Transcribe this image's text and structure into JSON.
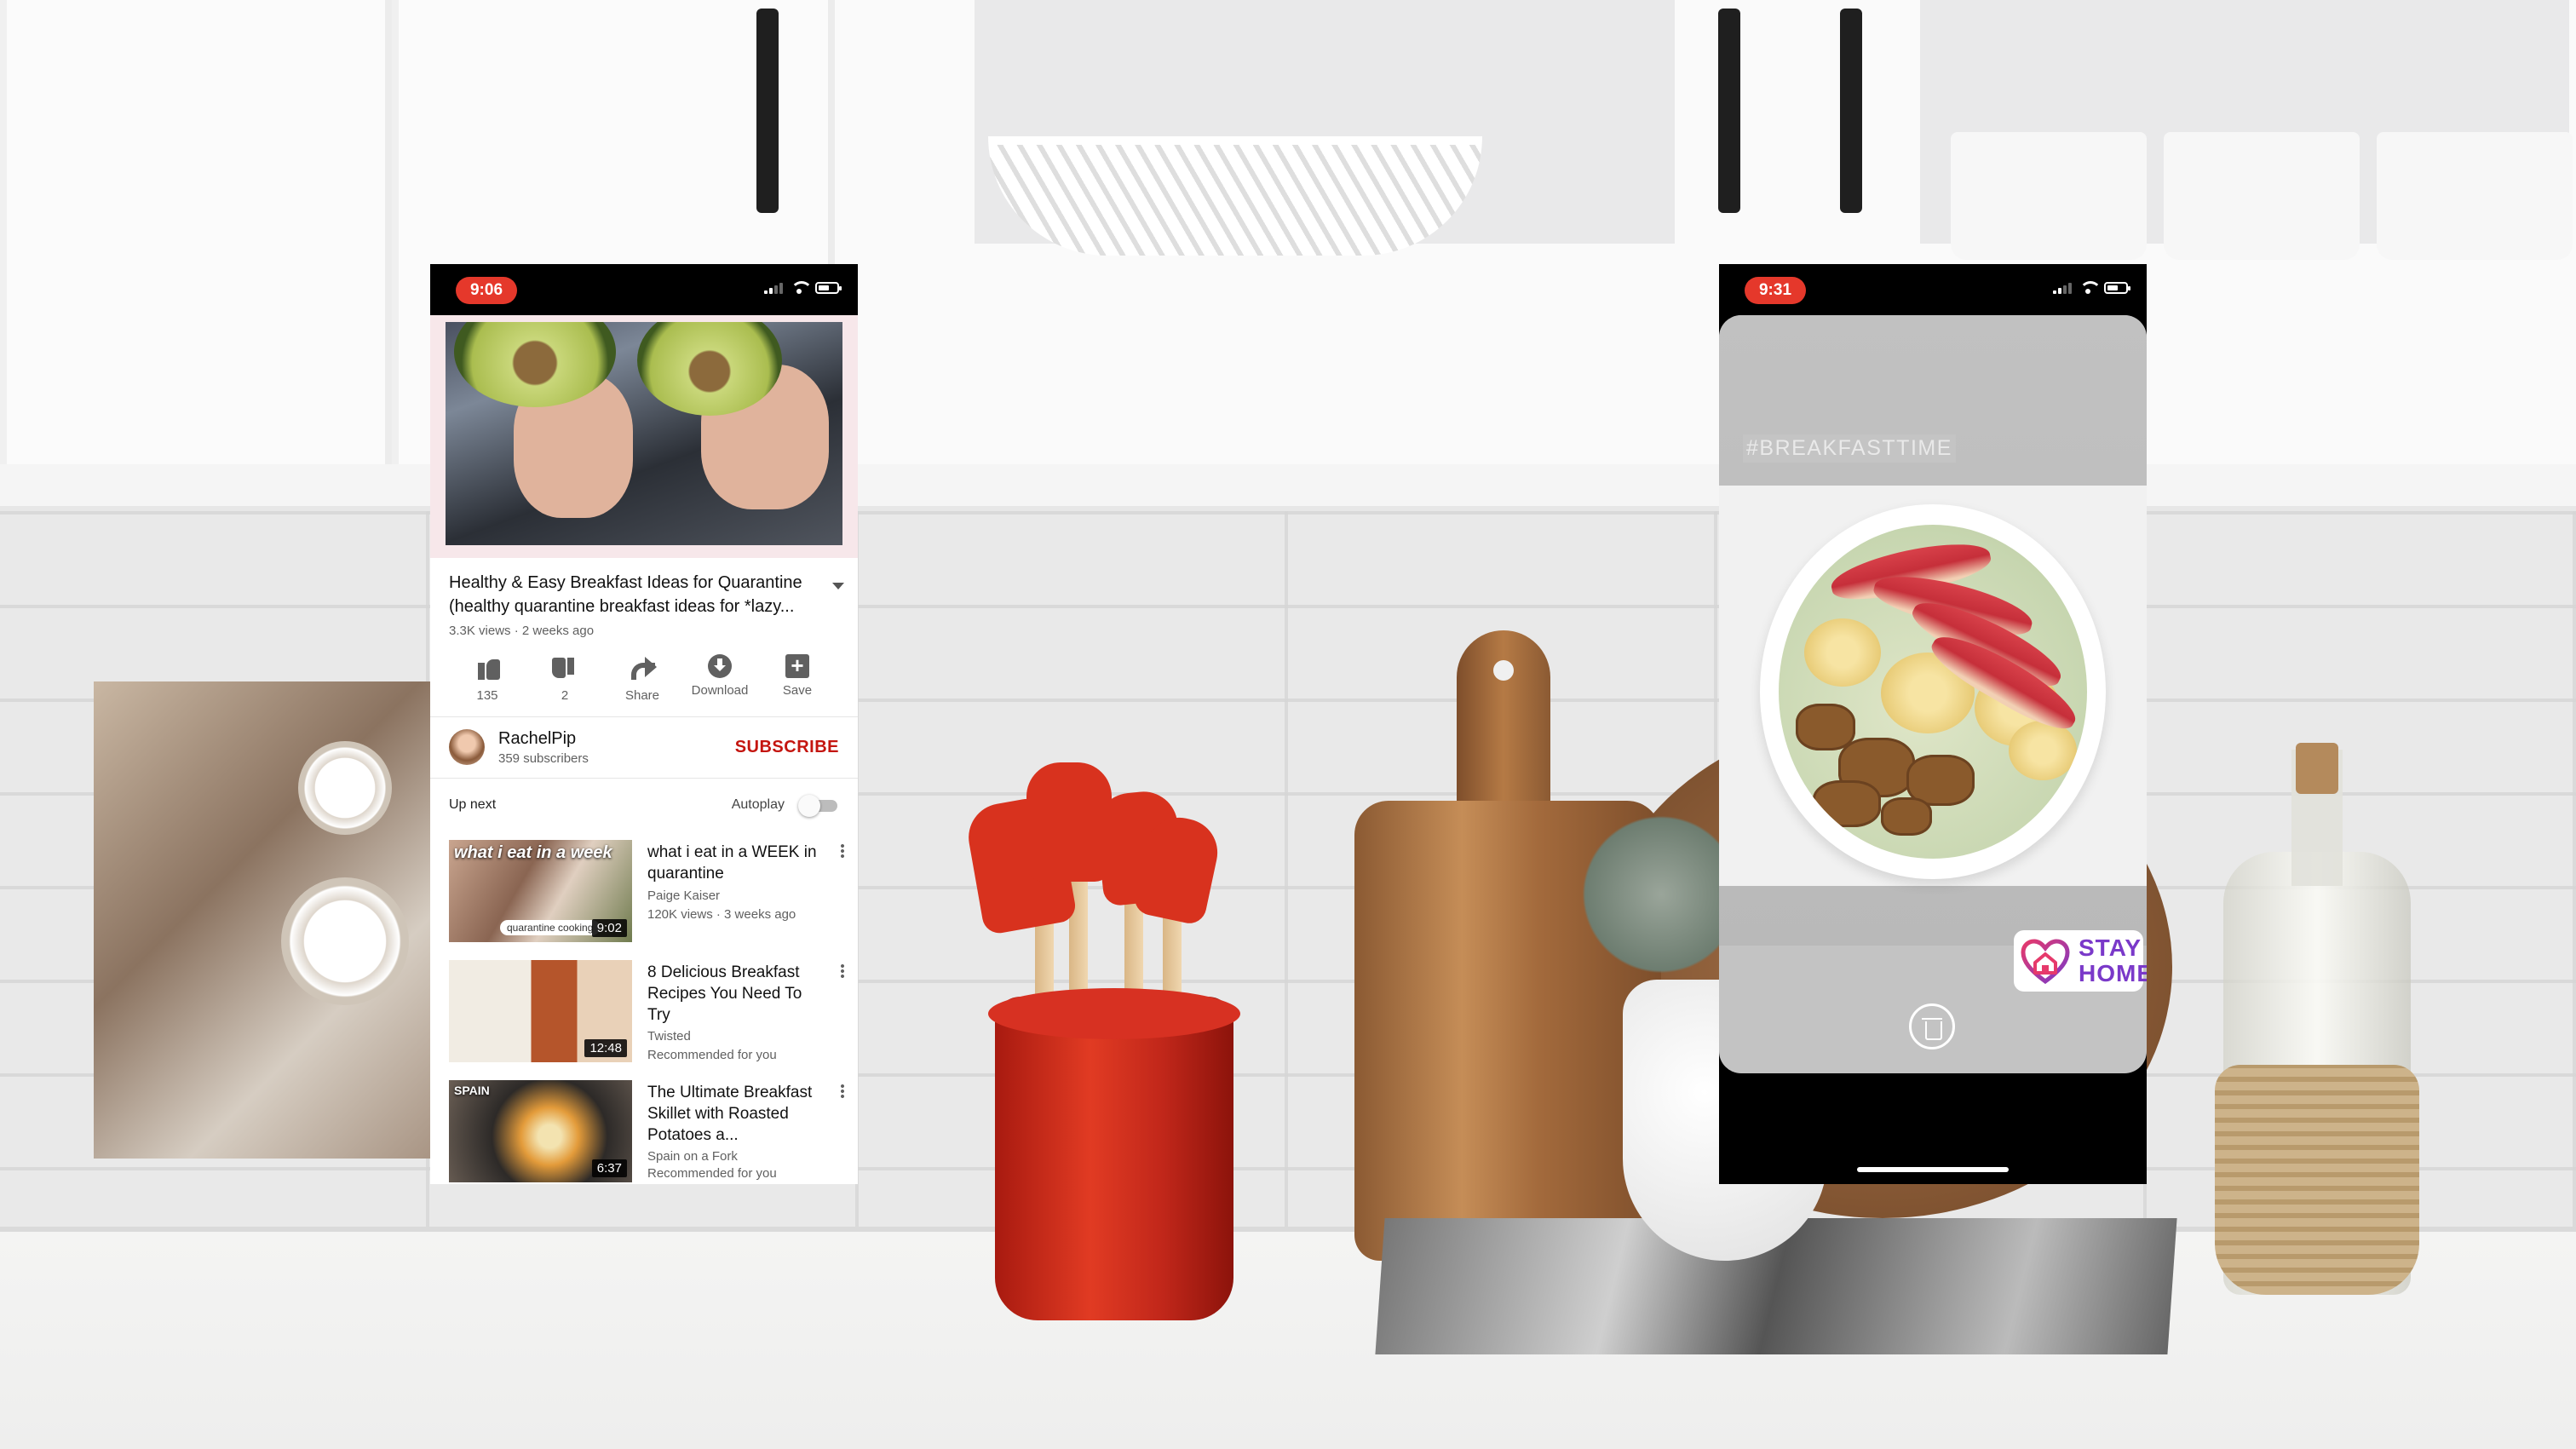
{
  "youtube_phone": {
    "status": {
      "time": "9:06"
    },
    "video": {
      "title_line1": "Healthy & Easy Breakfast Ideas for Quarantine",
      "title_line2": "(healthy quarantine breakfast ideas for *lazy...",
      "meta": "3.3K views · 2 weeks ago"
    },
    "actions": {
      "like_count": "135",
      "dislike_count": "2",
      "share_label": "Share",
      "download_label": "Download",
      "save_label": "Save"
    },
    "channel": {
      "name": "RachelPip",
      "subscribers": "359 subscribers",
      "subscribe_label": "SUBSCRIBE"
    },
    "up_next": {
      "label": "Up next",
      "autoplay_label": "Autoplay",
      "autoplay_on": false
    },
    "videos": [
      {
        "title": "what i eat in a WEEK in quarantine",
        "channel": "Paige Kaiser",
        "meta": "120K views · 3 weeks ago",
        "duration": "9:02",
        "thumb_text": "what i eat in a week",
        "thumb_stamp": "quarantine cooking"
      },
      {
        "title": "8 Delicious Breakfast Recipes You Need To Try",
        "channel": "Twisted",
        "meta": "Recommended for you",
        "duration": "12:48"
      },
      {
        "title": "The Ultimate Breakfast Skillet with Roasted Potatoes a...",
        "channel": "Spain on a Fork",
        "meta": "Recommended for you",
        "duration": "6:37",
        "thumb_text": "SPAIN"
      }
    ]
  },
  "instagram_phone": {
    "status": {
      "time": "9:31"
    },
    "story": {
      "hashtag": "#BREAKFASTTIME",
      "sticker_line1": "STAY",
      "sticker_line2": "HOME"
    }
  },
  "colors": {
    "youtube_red": "#c4150f",
    "status_pill": "#e5382b",
    "sticker_purple": "#7a39c9"
  }
}
